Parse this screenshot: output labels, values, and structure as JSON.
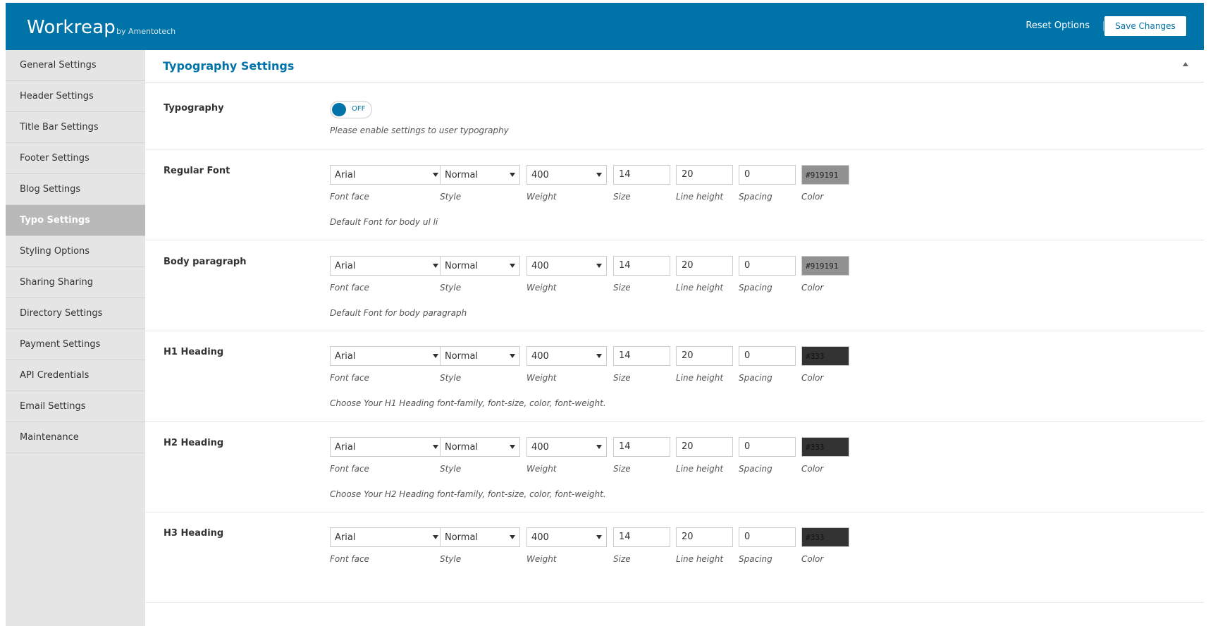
{
  "header": {
    "brand": "Workreap",
    "byline": "by Amentotech",
    "reset_label": "Reset Options",
    "save_label": "Save Changes"
  },
  "sidebar": {
    "items": [
      {
        "label": "General Settings"
      },
      {
        "label": "Header Settings"
      },
      {
        "label": "Title Bar Settings"
      },
      {
        "label": "Footer Settings"
      },
      {
        "label": "Blog Settings"
      },
      {
        "label": "Typo Settings",
        "active": true
      },
      {
        "label": "Styling Options"
      },
      {
        "label": "Sharing Sharing"
      },
      {
        "label": "Directory Settings"
      },
      {
        "label": "Payment Settings"
      },
      {
        "label": "API Credentials"
      },
      {
        "label": "Email Settings"
      },
      {
        "label": "Maintenance"
      }
    ]
  },
  "section": {
    "title": "Typography Settings",
    "typography_toggle": {
      "label": "Typography",
      "state": "OFF",
      "description": "Please enable settings to user typography"
    },
    "sub_labels": {
      "face": "Font face",
      "style": "Style",
      "weight": "Weight",
      "size": "Size",
      "line_height": "Line height",
      "spacing": "Spacing",
      "color": "Color"
    },
    "fonts": [
      {
        "label": "Regular Font",
        "face": "Arial",
        "style": "Normal",
        "weight": "400",
        "size": "14",
        "line_height": "20",
        "spacing": "0",
        "color": "#919191",
        "description": "Default Font for body ul li"
      },
      {
        "label": "Body paragraph",
        "face": "Arial",
        "style": "Normal",
        "weight": "400",
        "size": "14",
        "line_height": "20",
        "spacing": "0",
        "color": "#919191",
        "description": "Default Font for body paragraph"
      },
      {
        "label": "H1 Heading",
        "face": "Arial",
        "style": "Normal",
        "weight": "400",
        "size": "14",
        "line_height": "20",
        "spacing": "0",
        "color": "#333",
        "description": "Choose Your H1 Heading font-family, font-size, color, font-weight."
      },
      {
        "label": "H2 Heading",
        "face": "Arial",
        "style": "Normal",
        "weight": "400",
        "size": "14",
        "line_height": "20",
        "spacing": "0",
        "color": "#333",
        "description": "Choose Your H2 Heading font-family, font-size, color, font-weight."
      },
      {
        "label": "H3 Heading",
        "face": "Arial",
        "style": "Normal",
        "weight": "400",
        "size": "14",
        "line_height": "20",
        "spacing": "0",
        "color": "#333",
        "description": ""
      }
    ]
  },
  "colors": {
    "accent": "#0073a8",
    "sidebar_bg": "#e5e5e5",
    "sidebar_active": "#b9b9b9"
  }
}
